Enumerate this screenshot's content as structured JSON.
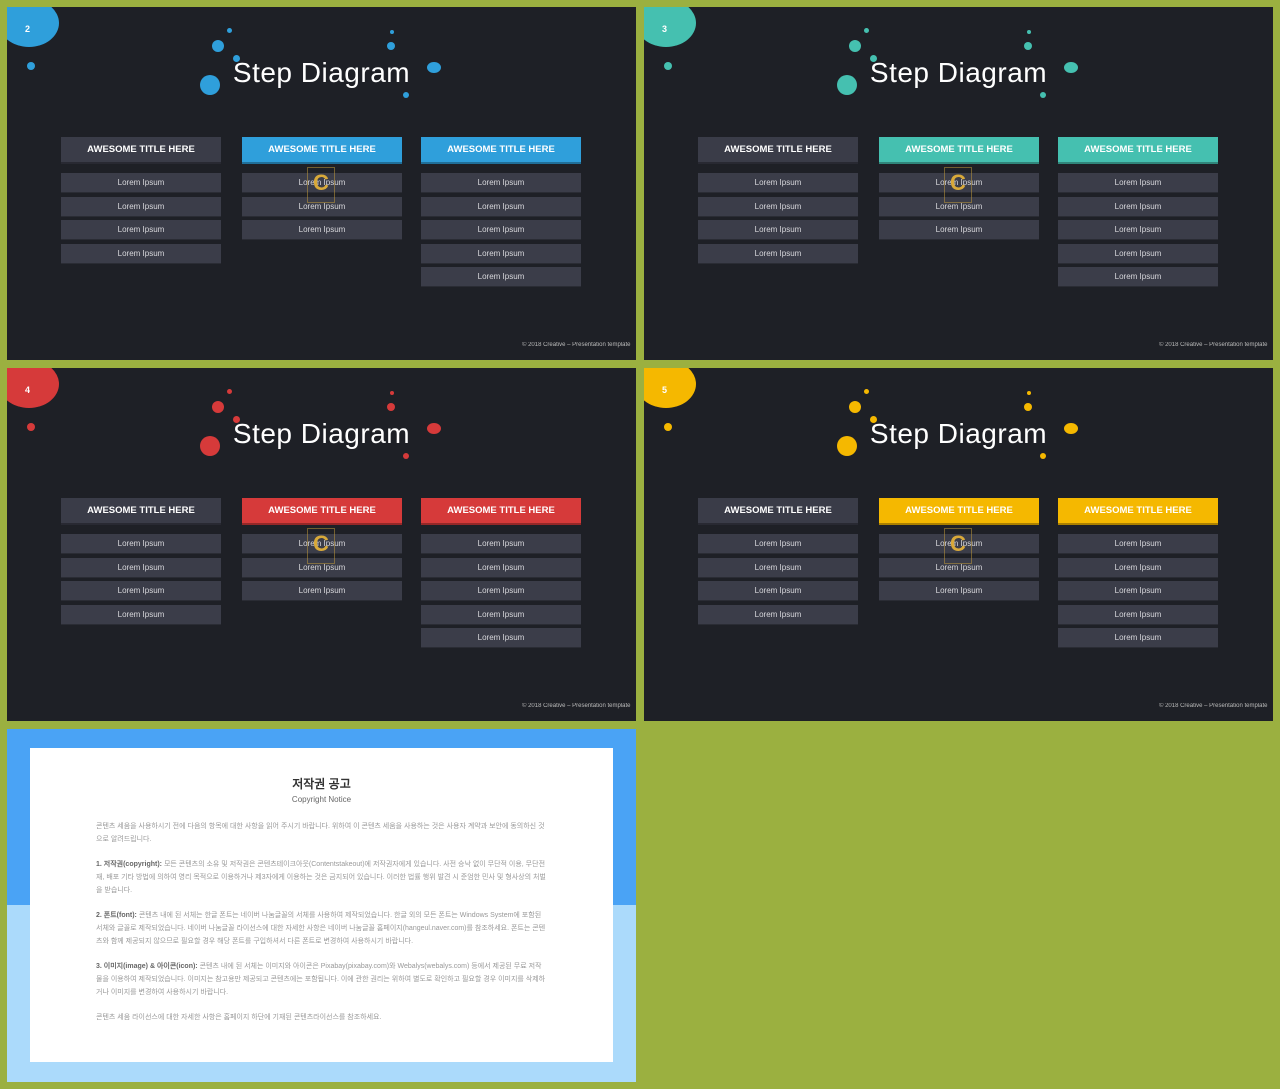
{
  "slides": [
    {
      "number": "2",
      "accent": "#2f9fdb"
    },
    {
      "number": "3",
      "accent": "#45c0b0"
    },
    {
      "number": "4",
      "accent": "#d63a3a"
    },
    {
      "number": "5",
      "accent": "#f5b800"
    }
  ],
  "title": "Step Diagram",
  "column_title": "AWESOME TITLE HERE",
  "item_label": "Lorem Ipsum",
  "column_item_counts": [
    4,
    3,
    5
  ],
  "footer": "© 2018 Creative – Presentation template",
  "watermark": "C",
  "copyright": {
    "title": "저작권 공고",
    "subtitle": "Copyright Notice",
    "intro": "콘텐츠 세움을 사용하시기 전에 다음의 항목에 대한 사항을 읽어 주시기 바랍니다. 위하여 이 콘텐츠 세움을 사용하는 것은 사용자 계약과 보안에 동의하신 것으로 알려드립니다.",
    "s1_label": "1. 저작권(copyright):",
    "s1": "모든 콘텐츠의 소유 및 저작권은 콘텐츠테이크아웃(Contentstakeout)에 저작권자에게 있습니다. 사전 승낙 없이 무단적 이용, 무단전재, 배포 기타 방법에 의하여 영리 목적으로 이용하거나 제3자에게 이용하는 것은 금지되어 있습니다. 이러한 법률 행위 발견 시 준엄한 민사 및 형사상의 처벌을 받습니다.",
    "s2_label": "2. 폰트(font):",
    "s2": "콘텐츠 내에 된 서체는 한글 폰트는 네이버 나눔글꼴의 서체를 사용하여 제작되었습니다. 한글 외의 모든 폰트는 Windows System에 포함된 서체와 글꼴로 제작되었습니다. 네이버 나눔글꼴 라이선스에 대한 자세한 사항은 네이버 나눔글꼴 홈페이지(hangeul.naver.com)를 참조하세요. 폰트는 콘텐츠와 함께 제공되지 않으므로 필요할 경우 해당 폰트를 구입하셔서 다른 폰트로 변경하여 사용하시기 바랍니다.",
    "s3_label": "3. 이미지(image) & 아이콘(icon):",
    "s3": "콘텐츠 내에 된 서체는 이미지와 아이콘은 Pixabay(pixabay.com)와 Webalys(webalys.com) 등에서 제공된 무료 저작물을 이용하여 제작되었습니다. 이미지는 참고용만 제공되고 콘텐츠에는 포함됩니다. 이에 관한 권리는 위하여 별도로 확인하고 필요할 경우 이미지를 삭제하거나 이미지를 변경하여 사용하시기 바랍니다.",
    "outro": "콘텐츠 세움 라이선스에 대한 자세한 사항은 홈페이지 하단에 기재된 콘텐츠라이선스를 참조하세요."
  }
}
